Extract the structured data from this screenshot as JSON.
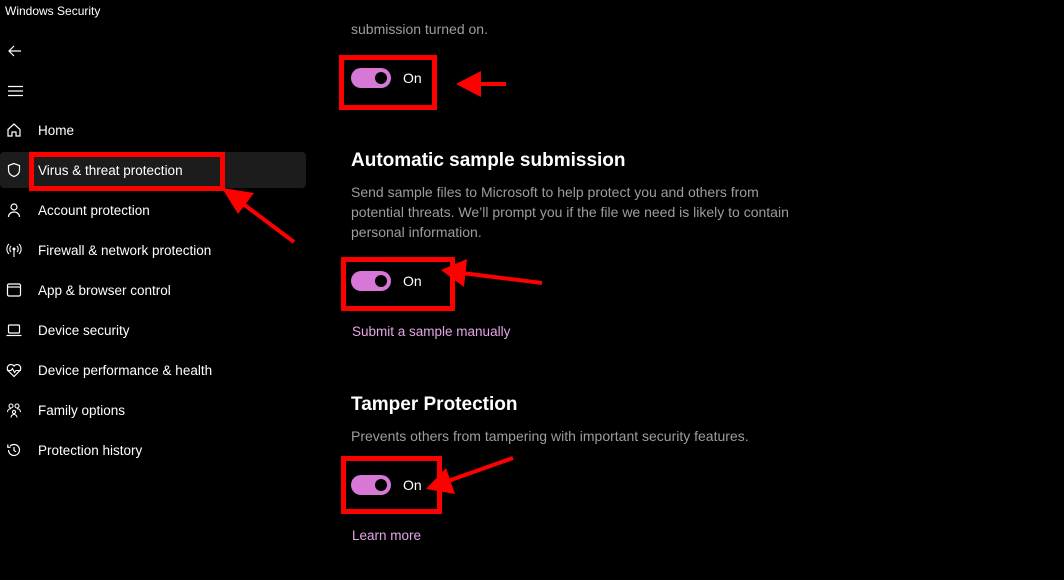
{
  "window": {
    "title": "Windows Security"
  },
  "nav": {
    "back_icon": "back-arrow-icon",
    "menu_icon": "hamburger-menu-icon"
  },
  "sidebar": {
    "items": [
      {
        "label": "Home",
        "icon": "home-icon"
      },
      {
        "label": "Virus & threat protection",
        "icon": "shield-icon",
        "selected": true
      },
      {
        "label": "Account protection",
        "icon": "person-icon"
      },
      {
        "label": "Firewall & network protection",
        "icon": "wireless-antenna-icon"
      },
      {
        "label": "App & browser control",
        "icon": "app-window-icon"
      },
      {
        "label": "Device security",
        "icon": "laptop-icon"
      },
      {
        "label": "Device performance & health",
        "icon": "heart-pulse-icon"
      },
      {
        "label": "Family options",
        "icon": "family-icon"
      },
      {
        "label": "Protection history",
        "icon": "history-icon"
      }
    ]
  },
  "main": {
    "cloud_section": {
      "partial_desc": "submission turned on.",
      "toggle": {
        "state": "On"
      }
    },
    "sample_section": {
      "heading": "Automatic sample submission",
      "desc_lines": [
        "Send sample files to Microsoft to help protect you and others from",
        "potential threats. We’ll prompt you if the file we need is likely to contain",
        "personal information."
      ],
      "toggle": {
        "state": "On"
      },
      "link": "Submit a sample manually"
    },
    "tamper_section": {
      "heading": "Tamper Protection",
      "desc": "Prevents others from tampering with important security features.",
      "toggle": {
        "state": "On"
      },
      "link": "Learn more"
    }
  },
  "colors": {
    "background": "#000000",
    "toggle_on": "#d778d6",
    "link": "#e3a6e6",
    "annotation": "#ff0000",
    "selected_bg": "#1c1c1c"
  }
}
